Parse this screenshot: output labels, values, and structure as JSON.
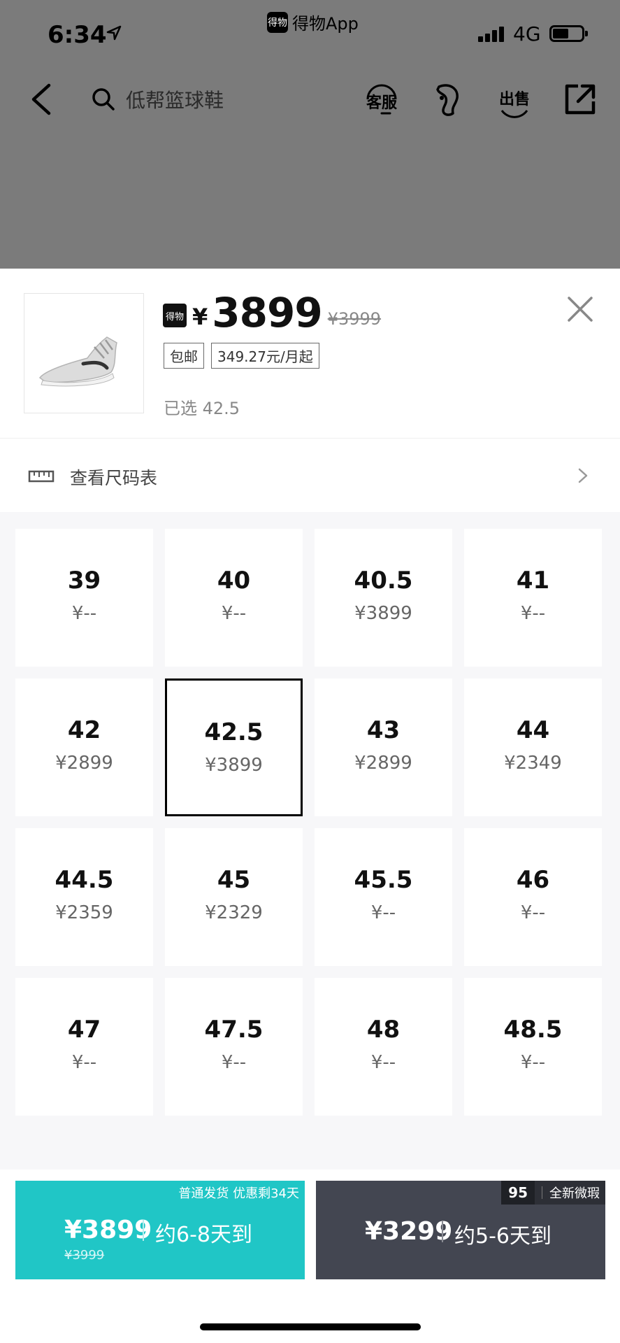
{
  "status_bar": {
    "time": "6:34",
    "app_label": "得物App",
    "app_logo_text": "得物",
    "network": "4G"
  },
  "nav": {
    "search_placeholder": "低帮篮球鞋",
    "customer_service_label": "客服",
    "sell_label": "出售",
    "icons": [
      "back-icon",
      "search-icon",
      "customer-service-icon",
      "footprint-icon",
      "sell-icon",
      "share-icon"
    ]
  },
  "product": {
    "badge": "得物",
    "currency": "¥",
    "price": "3899",
    "original_price": "¥3999",
    "tags": [
      "包邮",
      "349.27元/月起"
    ],
    "selected_label": "已选 42.5"
  },
  "size_chart": {
    "label": "查看尺码表"
  },
  "sizes": [
    {
      "size": "39",
      "price": "¥--"
    },
    {
      "size": "40",
      "price": "¥--"
    },
    {
      "size": "40.5",
      "price": "¥3899"
    },
    {
      "size": "41",
      "price": "¥--"
    },
    {
      "size": "42",
      "price": "¥2899"
    },
    {
      "size": "42.5",
      "price": "¥3899",
      "selected": true
    },
    {
      "size": "43",
      "price": "¥2899"
    },
    {
      "size": "44",
      "price": "¥2349"
    },
    {
      "size": "44.5",
      "price": "¥2359"
    },
    {
      "size": "45",
      "price": "¥2329"
    },
    {
      "size": "45.5",
      "price": "¥--"
    },
    {
      "size": "46",
      "price": "¥--"
    },
    {
      "size": "47",
      "price": "¥--"
    },
    {
      "size": "47.5",
      "price": "¥--"
    },
    {
      "size": "48",
      "price": "¥--"
    },
    {
      "size": "48.5",
      "price": "¥--"
    }
  ],
  "buy_standard": {
    "note": "普通发货 优惠剩34天",
    "price": "¥3899",
    "original_price": "¥3999",
    "eta": "约6-8天到",
    "color": "#20c6c6"
  },
  "buy_express": {
    "badge_brand": "95",
    "badge_label": "全新微瑕",
    "price": "¥3299",
    "eta": "约5-6天到",
    "color": "#434651"
  }
}
